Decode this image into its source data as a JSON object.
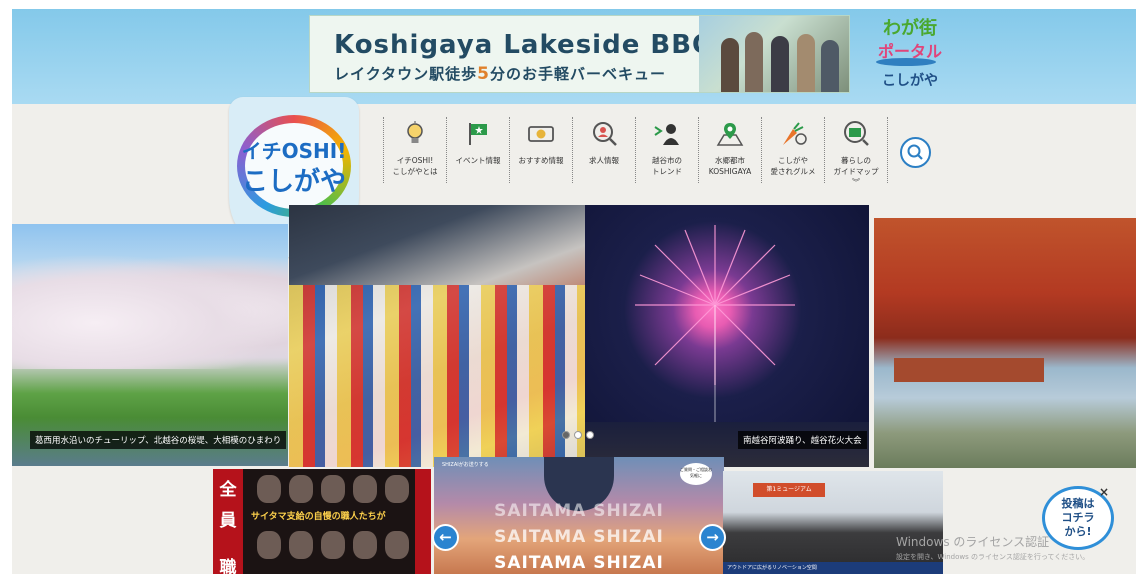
{
  "ad": {
    "title": "Koshigaya Lakeside BBQ",
    "sub_before": "レイクタウン駅徒歩",
    "sub_highlight": "5",
    "sub_after": "分のお手軽バーベキュー"
  },
  "portal": {
    "line1": "わが街",
    "line2": "ポータル",
    "line3": "こしがや"
  },
  "logo": {
    "line1": "イチOSHI!",
    "line2": "こしがや"
  },
  "nav": {
    "items": [
      {
        "label": "イチOSHI!\nこしがやとは",
        "icon": "lightbulb-icon"
      },
      {
        "label": "イベント情報",
        "icon": "flag-icon"
      },
      {
        "label": "おすすめ情報",
        "icon": "ticket-icon"
      },
      {
        "label": "求人情報",
        "icon": "person-search-icon"
      },
      {
        "label": "越谷市の\nトレンド",
        "icon": "trend-icon"
      },
      {
        "label": "水郷都市\nKOSHIGAYA",
        "icon": "map-pin-icon"
      },
      {
        "label": "こしがや\n愛されグルメ",
        "icon": "carrot-icon"
      },
      {
        "label": "暮らしの\nガイドマップ",
        "icon": "shop-search-icon",
        "more": "︾"
      }
    ]
  },
  "slider": {
    "caption_left": "葛西用水沿いのチューリップ、北越谷の桜堤、大相模のひまわり",
    "caption_right": "南越谷阿波踊り、越谷花火大会",
    "dots": 3,
    "active_dot": 1
  },
  "bottom": {
    "card1_vertical": [
      "全",
      "員"
    ],
    "card1_bottom": "職",
    "card1_tag": "サイタマ支給の自慢の職人たちが",
    "card2_top_text": "SHIZAIがお送りする",
    "card2_badge": "ご質問・ご相談お気軽に",
    "card2_lines": [
      "SAITAMA SHIZAI",
      "SAITAMA SHIZAI",
      "SAITAMA SHIZAI"
    ],
    "card3_sign": "第1ミュージアム",
    "card3_strip": "アウトドアに広がるリノベーション空間"
  },
  "post": {
    "line1": "投稿は",
    "line2": "コチラ",
    "line3": "から!",
    "close": "×"
  },
  "watermark": {
    "line1": "Windows のライセンス認証",
    "line2": "設定を開き、Windows のライセンス認証を行ってください。"
  },
  "colors": {
    "accent": "#2c7fc4",
    "banner": "#84c9ea",
    "paper": "#f0efeb"
  }
}
